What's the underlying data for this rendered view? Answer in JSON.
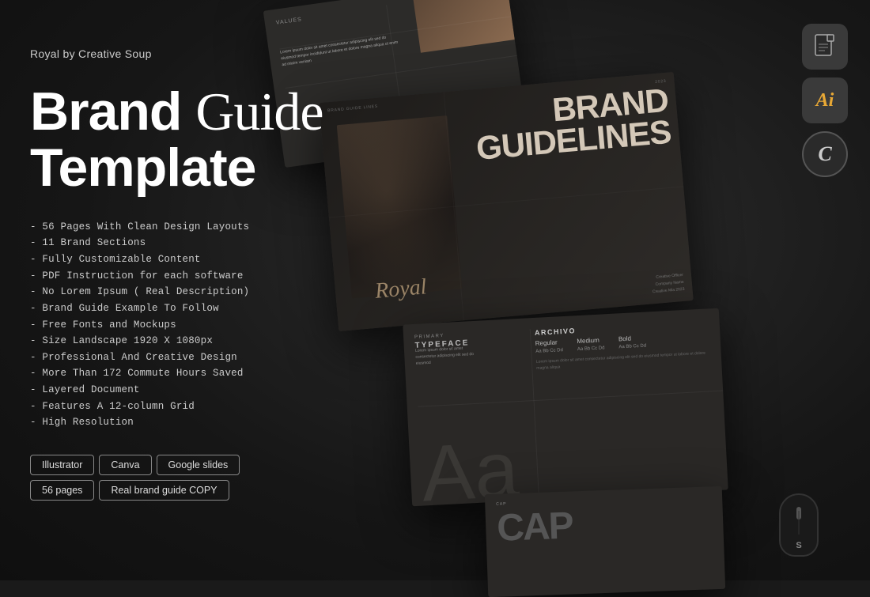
{
  "brand": {
    "label": "Royal by Creative Soup"
  },
  "title": {
    "line1_bold": "Brand ",
    "line1_serif": "Guide",
    "line2": "Template"
  },
  "features": [
    "- 56 Pages With Clean Design Layouts",
    "- 11 Brand Sections",
    "- Fully Customizable Content",
    "- PDF Instruction for each software",
    "- No Lorem Ipsum ( Real Description)",
    "- Brand Guide Example To Follow",
    "- Free Fonts and Mockups",
    "- Size Landscape 1920 X 1080px",
    "- Professional And Creative Design",
    "- More Than 172 Commute Hours Saved",
    "- Layered Document",
    "- Features A 12-column Grid",
    "- High Resolution"
  ],
  "tags": {
    "row1": [
      "Illustrator",
      "Canva",
      "Google slides"
    ],
    "row2": [
      "56 pages",
      "Real brand guide COPY"
    ]
  },
  "icons": {
    "file_label": "📄",
    "ai_label": "Ai",
    "canva_label": "C"
  },
  "slides": {
    "values_label": "VALUES",
    "brand_title1": "BRAND",
    "brand_title2": "GUIDELINES",
    "brand_script": "Royal",
    "typeface_label": "PRIMARY",
    "typeface_title": "TYPEFACE",
    "archivo_title": "ARCHIVO",
    "weights": [
      "Regular",
      "Medium",
      "Bold"
    ],
    "cap_label": "CAP",
    "big_aa": "Aa"
  }
}
